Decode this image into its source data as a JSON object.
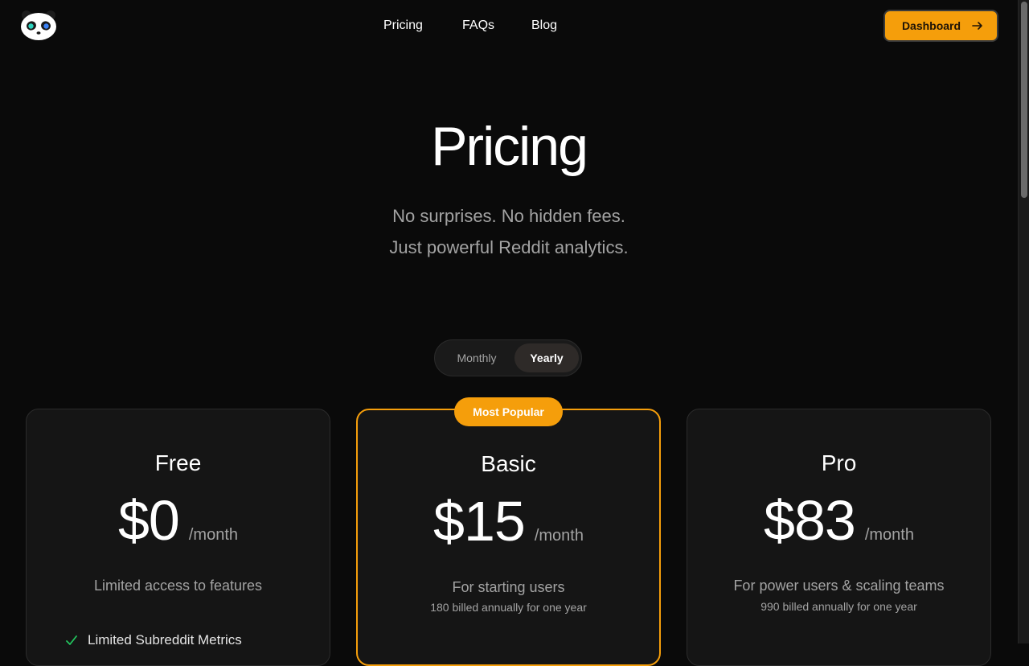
{
  "header": {
    "logo_icon": "panda-logo-icon",
    "nav": {
      "pricing": "Pricing",
      "faqs": "FAQs",
      "blog": "Blog"
    },
    "dashboard_label": "Dashboard",
    "dashboard_icon": "arrow-right-icon"
  },
  "hero": {
    "title": "Pricing",
    "subtitle_line1": "No surprises. No hidden fees.",
    "subtitle_line2": "Just powerful Reddit analytics."
  },
  "billing_toggle": {
    "monthly": "Monthly",
    "yearly": "Yearly",
    "selected": "Yearly"
  },
  "plans": [
    {
      "name": "Free",
      "price": "$0",
      "period": "/month",
      "description": "Limited access to features",
      "billing_note": "",
      "features": [
        "Limited Subreddit Metrics"
      ]
    },
    {
      "name": "Basic",
      "badge": "Most Popular",
      "price": "$15",
      "period": "/month",
      "description": "For starting users",
      "billing_note": "180 billed annually for one year"
    },
    {
      "name": "Pro",
      "price": "$83",
      "period": "/month",
      "description": "For power users & scaling teams",
      "billing_note": "990 billed annually for one year"
    }
  ],
  "colors": {
    "background": "#0a0a0a",
    "accent": "#f59e0b",
    "card": "#151515",
    "muted_text": "#a3a3a3",
    "check": "#22c55e"
  }
}
